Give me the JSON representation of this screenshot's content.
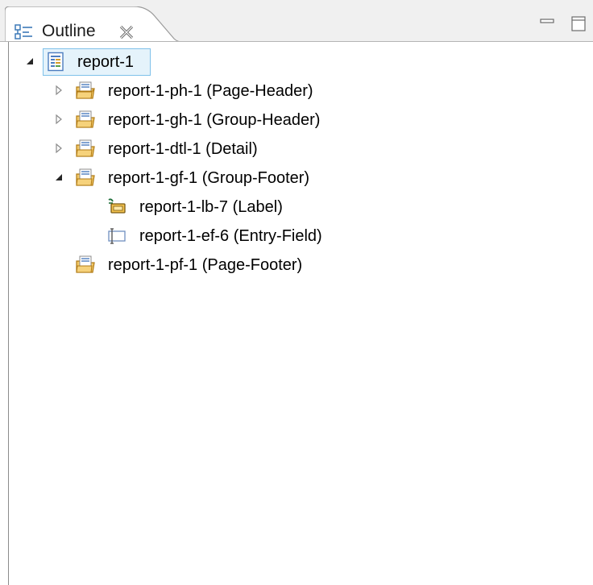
{
  "tab": {
    "title": "Outline",
    "icon": "outline-icon",
    "close_icon": "close-icon"
  },
  "window_controls": {
    "minimize_icon": "minimize-icon",
    "maximize_icon": "maximize-icon"
  },
  "tree": {
    "root": {
      "label": "report-1",
      "icon": "report-icon",
      "expanded": true,
      "selected": true
    },
    "children": [
      {
        "label": "report-1-ph-1 (Page-Header)",
        "icon": "section-folder-icon",
        "expanded": false
      },
      {
        "label": "report-1-gh-1 (Group-Header)",
        "icon": "section-folder-icon",
        "expanded": false
      },
      {
        "label": "report-1-dtl-1 (Detail)",
        "icon": "section-folder-icon",
        "expanded": false
      },
      {
        "label": "report-1-gf-1 (Group-Footer)",
        "icon": "section-folder-icon",
        "expanded": true,
        "children": [
          {
            "label": "report-1-lb-7 (Label)",
            "icon": "label-icon"
          },
          {
            "label": "report-1-ef-6 (Entry-Field)",
            "icon": "entry-field-icon"
          }
        ]
      },
      {
        "label": "report-1-pf-1 (Page-Footer)",
        "icon": "section-folder-icon"
      }
    ]
  },
  "colors": {
    "selection_fill": "#e5f3fb",
    "selection_border": "#7fc1ea",
    "tab_border": "#9a9a9a"
  }
}
